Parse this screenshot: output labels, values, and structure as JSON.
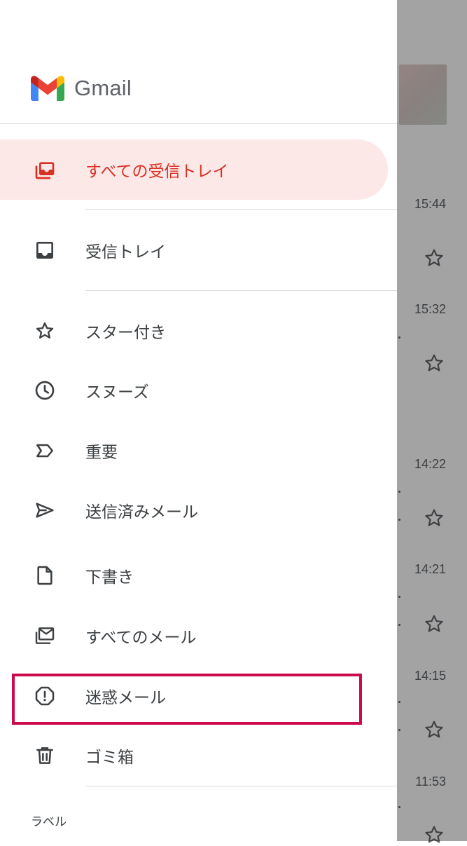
{
  "app": {
    "name": "Gmail"
  },
  "drawer": {
    "items": [
      {
        "label": "すべての受信トレイ",
        "icon": "all-inboxes-icon",
        "active": true
      },
      {
        "label": "受信トレイ",
        "icon": "inbox-icon",
        "active": false
      },
      {
        "label": "スター付き",
        "icon": "star-icon",
        "active": false
      },
      {
        "label": "スヌーズ",
        "icon": "clock-icon",
        "active": false
      },
      {
        "label": "重要",
        "icon": "label-important-icon",
        "active": false
      },
      {
        "label": "送信済みメール",
        "icon": "send-icon",
        "active": false
      },
      {
        "label": "下書き",
        "icon": "draft-icon",
        "active": false
      },
      {
        "label": "すべてのメール",
        "icon": "all-mail-icon",
        "active": false
      },
      {
        "label": "迷惑メール",
        "icon": "spam-icon",
        "active": false,
        "highlighted": true
      },
      {
        "label": "ゴミ箱",
        "icon": "trash-icon",
        "active": false
      }
    ],
    "section_label": "ラベル"
  },
  "background_list": {
    "times": [
      "15:44",
      "15:32",
      "14:22",
      "14:21",
      "14:15",
      "11:53"
    ]
  },
  "colors": {
    "active_bg": "#fce8e6",
    "active_text": "#d93025",
    "highlight_border": "#cc0a4e"
  }
}
